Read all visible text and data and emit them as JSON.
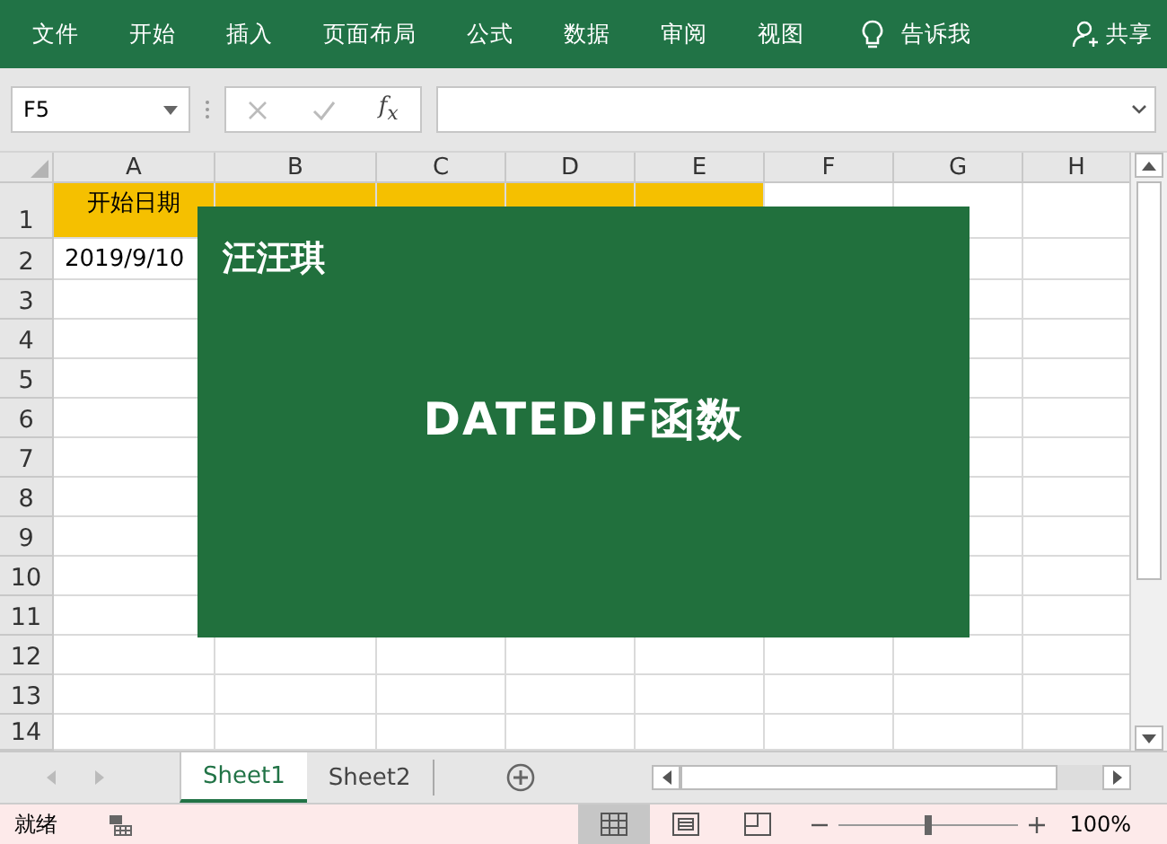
{
  "ribbon": {
    "tabs": [
      "文件",
      "开始",
      "插入",
      "页面布局",
      "公式",
      "数据",
      "审阅",
      "视图"
    ],
    "tell_me": "告诉我",
    "share": "共享"
  },
  "formula_bar": {
    "name_box": "F5",
    "function_label": "f$_{x}$"
  },
  "grid": {
    "columns": [
      "A",
      "B",
      "C",
      "D",
      "E",
      "F",
      "G",
      "H"
    ],
    "rows": [
      {
        "number": "1",
        "cells": [
          {
            "text": "开始日期",
            "highlighted": true
          },
          {
            "highlighted": true
          },
          {
            "highlighted": true
          },
          {
            "highlighted": true
          },
          {
            "highlighted": true
          }
        ]
      },
      {
        "number": "2",
        "cells": [
          {
            "text": "2019/9/10",
            "highlighted": false
          }
        ]
      },
      {
        "number": "3"
      },
      {
        "number": "4"
      },
      {
        "number": "5"
      },
      {
        "number": "6"
      },
      {
        "number": "7"
      },
      {
        "number": "8"
      },
      {
        "number": "9"
      },
      {
        "number": "10"
      },
      {
        "number": "11"
      },
      {
        "number": "12"
      },
      {
        "number": "13"
      },
      {
        "number": "14"
      }
    ]
  },
  "overlay": {
    "author": "汪汪琪",
    "title": "DATEDIF函数"
  },
  "sheet_tabs": [
    {
      "label": "Sheet1",
      "selected": true
    },
    {
      "label": "Sheet2",
      "selected": false
    }
  ],
  "status_bar": {
    "status": "就绪",
    "views": [
      {
        "kind": "normal",
        "selected": true
      },
      {
        "kind": "page_layout",
        "selected": false
      },
      {
        "kind": "page_break",
        "selected": false
      }
    ],
    "zoom_slider": {
      "level": 0.5
    },
    "zoom": "100%"
  }
}
